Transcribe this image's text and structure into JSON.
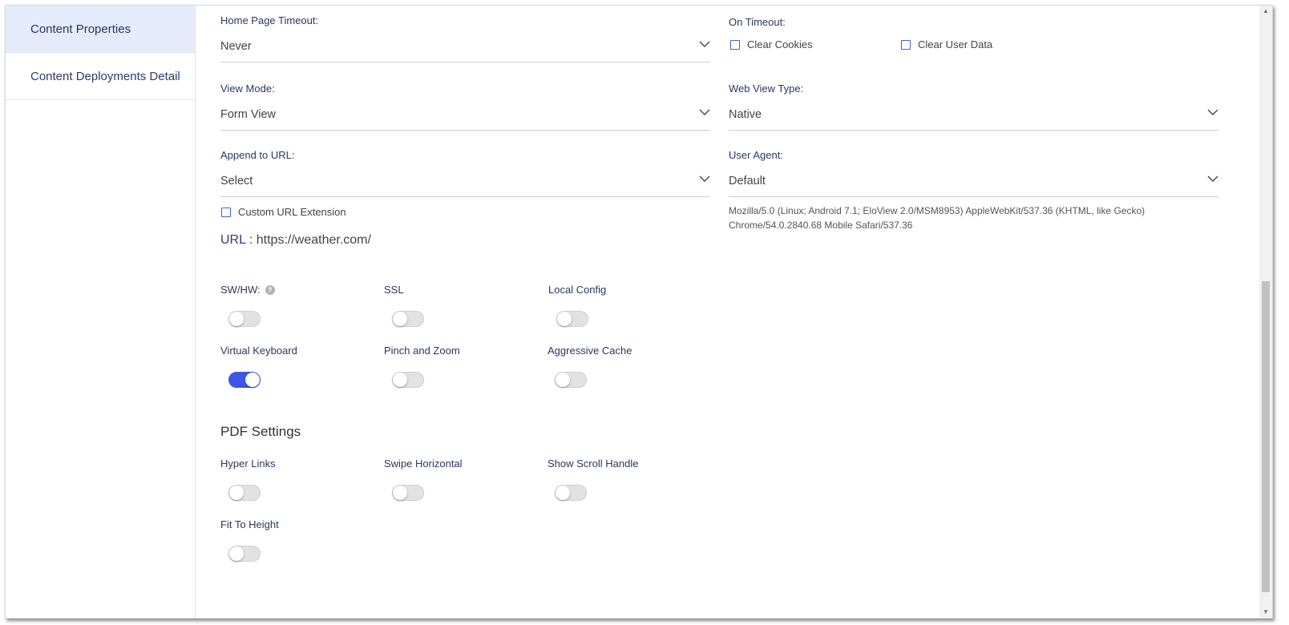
{
  "sidebar": {
    "items": [
      {
        "label": "Content Properties",
        "active": true
      },
      {
        "label": "Content Deployments Detail",
        "active": false
      }
    ]
  },
  "form": {
    "home_page_timeout": {
      "label": "Home Page Timeout:",
      "value": "Never"
    },
    "on_timeout": {
      "label": "On Timeout:",
      "clear_cookies": "Clear Cookies",
      "clear_user_data": "Clear User Data"
    },
    "view_mode": {
      "label": "View Mode:",
      "value": "Form View"
    },
    "web_view_type": {
      "label": "Web View Type:",
      "value": "Native"
    },
    "append_to_url": {
      "label": "Append to URL:",
      "value": "Select"
    },
    "user_agent": {
      "label": "User Agent:",
      "value": "Default",
      "string_line1": "Mozilla/5.0 (Linux; Android 7.1; EloView 2.0/MSM8953) AppleWebKit/537.36 (KHTML, like Gecko)",
      "string_line2": "Chrome/54.0.2840.68 Mobile Safari/537.36"
    },
    "custom_url_extension": "Custom URL Extension",
    "url": {
      "label": "URL",
      "separator": " : ",
      "value": "https://weather.com/"
    }
  },
  "toggles": {
    "sw_hw": {
      "label": "SW/HW:",
      "help": "?",
      "on": false
    },
    "ssl": {
      "label": "SSL",
      "on": false
    },
    "local_config": {
      "label": "Local Config",
      "on": false
    },
    "virtual_keyboard": {
      "label": "Virtual Keyboard",
      "on": true
    },
    "pinch_zoom": {
      "label": "Pinch and Zoom",
      "on": false
    },
    "aggressive_cache": {
      "label": "Aggressive Cache",
      "on": false
    }
  },
  "pdf": {
    "title": "PDF Settings",
    "hyper_links": {
      "label": "Hyper Links",
      "on": false
    },
    "swipe_horizontal": {
      "label": "Swipe Horizontal",
      "on": false
    },
    "show_scroll_handle": {
      "label": "Show Scroll Handle",
      "on": false
    },
    "fit_to_height": {
      "label": "Fit To Height",
      "on": false
    }
  },
  "colors": {
    "accent": "#3e56e6",
    "label": "#2a3763",
    "active_bg": "#e6ebfb"
  }
}
